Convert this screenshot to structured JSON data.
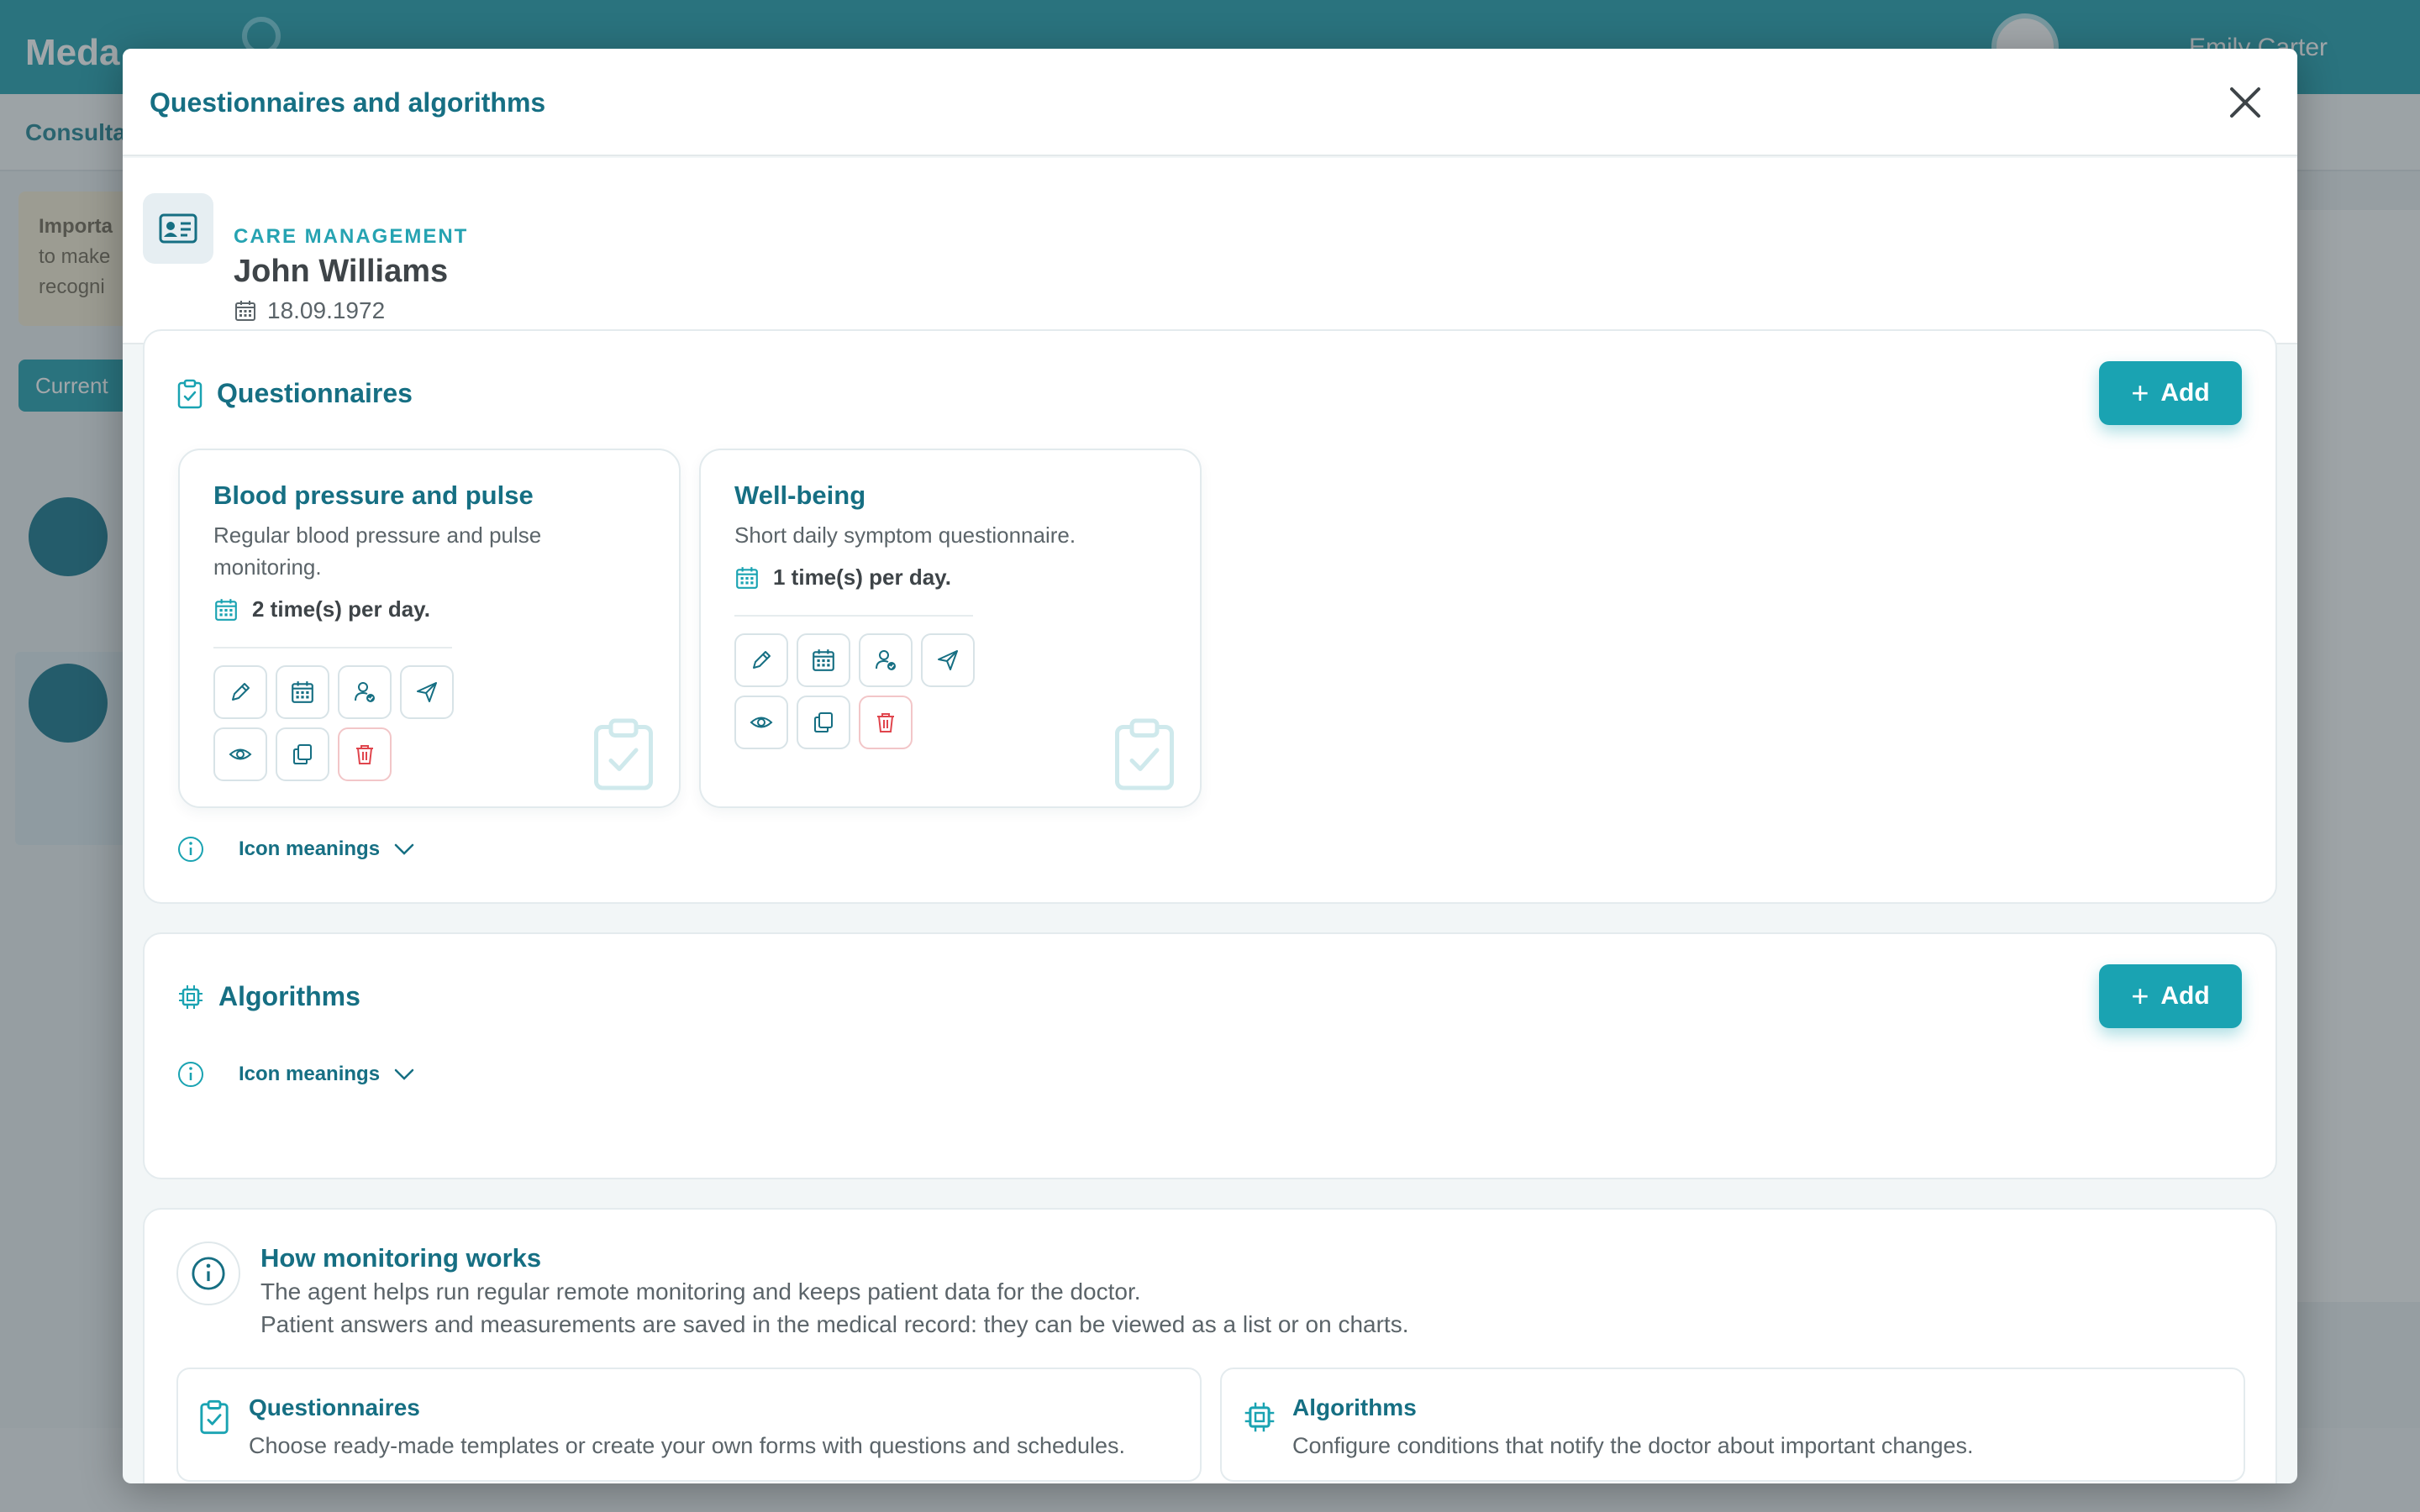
{
  "background": {
    "app_name": "Meda",
    "user_name": "Emily Carter",
    "page_subtitle": "Consulta",
    "notice_lines": [
      "Importa",
      "to make",
      "recogni"
    ],
    "current_label": "Current"
  },
  "modal": {
    "title": "Questionnaires and algorithms",
    "close_icon": "close-icon"
  },
  "patient": {
    "category": "CARE MANAGEMENT",
    "name": "John Williams",
    "dob": "18.09.1972"
  },
  "questionnaires": {
    "title": "Questionnaires",
    "add_label": "Add",
    "items": [
      {
        "title": "Blood pressure and pulse",
        "description": "Regular blood pressure and pulse monitoring.",
        "frequency": "2 time(s) per day."
      },
      {
        "title": "Well-being",
        "description": "Short daily symptom questionnaire.",
        "frequency": "1 time(s) per day."
      }
    ],
    "action_icons": [
      "edit-icon",
      "calendar-icon",
      "assign-user-icon",
      "send-icon",
      "view-icon",
      "copy-icon",
      "delete-icon"
    ],
    "icon_meanings_label": "Icon meanings"
  },
  "algorithms": {
    "title": "Algorithms",
    "add_label": "Add",
    "icon_meanings_label": "Icon meanings"
  },
  "how_monitoring": {
    "title": "How monitoring works",
    "line1": "The agent helps run regular remote monitoring and keeps patient data for the doctor.",
    "line2": "Patient answers and measurements are saved in the medical record: they can be viewed as a list or on charts.",
    "cards": [
      {
        "title": "Questionnaires",
        "description": "Choose ready-made templates or create your own forms with questions and schedules."
      },
      {
        "title": "Algorithms",
        "description": "Configure conditions that notify the doctor about important changes."
      }
    ]
  },
  "colors": {
    "primary": "#166f83",
    "accent": "#1aa3b2",
    "danger": "#e0454d"
  }
}
